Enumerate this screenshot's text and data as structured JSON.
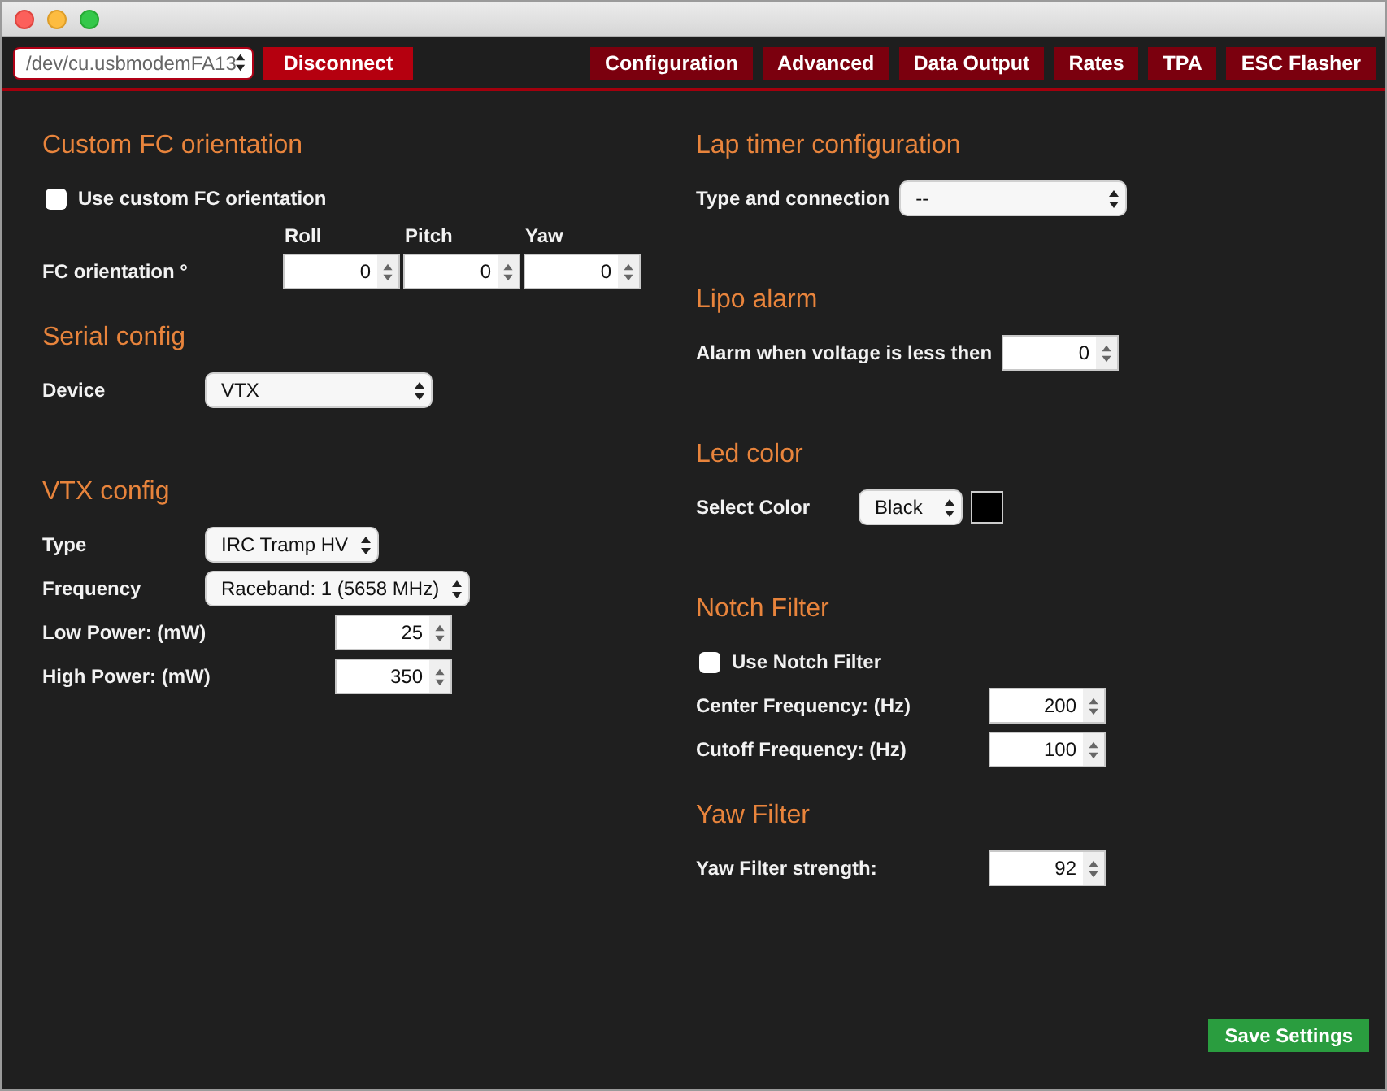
{
  "port_select": "/dev/cu.usbmodemFA13",
  "disconnect": "Disconnect",
  "nav": [
    "Configuration",
    "Advanced",
    "Data Output",
    "Rates",
    "TPA",
    "ESC Flasher"
  ],
  "columns": [
    [
      {
        "title": "Custom FC orientation",
        "rows": [
          {
            "kind": "checkbox",
            "label": "Use custom FC orientation",
            "checked": false
          },
          {
            "kind": "axes",
            "label": "FC orientation °",
            "axes": [
              {
                "name": "Roll",
                "value": "0"
              },
              {
                "name": "Pitch",
                "value": "0"
              },
              {
                "name": "Yaw",
                "value": "0"
              }
            ]
          }
        ]
      },
      {
        "title": "Serial config",
        "rows": [
          {
            "kind": "select",
            "label": "Device",
            "value": "VTX"
          }
        ]
      },
      {
        "title": "VTX config",
        "rows": [
          {
            "kind": "select",
            "label": "Type",
            "value": "IRC Tramp HV"
          },
          {
            "kind": "select",
            "label": "Frequency",
            "value": "Raceband: 1 (5658 MHz)"
          },
          {
            "kind": "number",
            "label": "Low Power: (mW)",
            "value": "25"
          },
          {
            "kind": "number",
            "label": "High Power: (mW)",
            "value": "350"
          }
        ]
      }
    ],
    [
      {
        "title": "Lap timer configuration",
        "rows": [
          {
            "kind": "select",
            "label": "Type and connection",
            "value": "--"
          }
        ]
      },
      {
        "title": "Lipo alarm",
        "rows": [
          {
            "kind": "number",
            "label": "Alarm when voltage is less then",
            "value": "0"
          }
        ]
      },
      {
        "title": "Led color",
        "rows": [
          {
            "kind": "color",
            "label": "Select Color",
            "value": "Black",
            "color": "#000000"
          }
        ]
      },
      {
        "title": "Notch Filter",
        "rows": [
          {
            "kind": "checkbox",
            "label": "Use Notch Filter",
            "checked": false
          },
          {
            "kind": "number",
            "label": "Center Frequency: (Hz)",
            "value": "200"
          },
          {
            "kind": "number",
            "label": "Cutoff Frequency: (Hz)",
            "value": "100"
          }
        ]
      },
      {
        "title": "Yaw Filter",
        "rows": [
          {
            "kind": "number",
            "label": "Yaw Filter strength:",
            "value": "92"
          }
        ]
      }
    ]
  ],
  "save": "Save Settings"
}
